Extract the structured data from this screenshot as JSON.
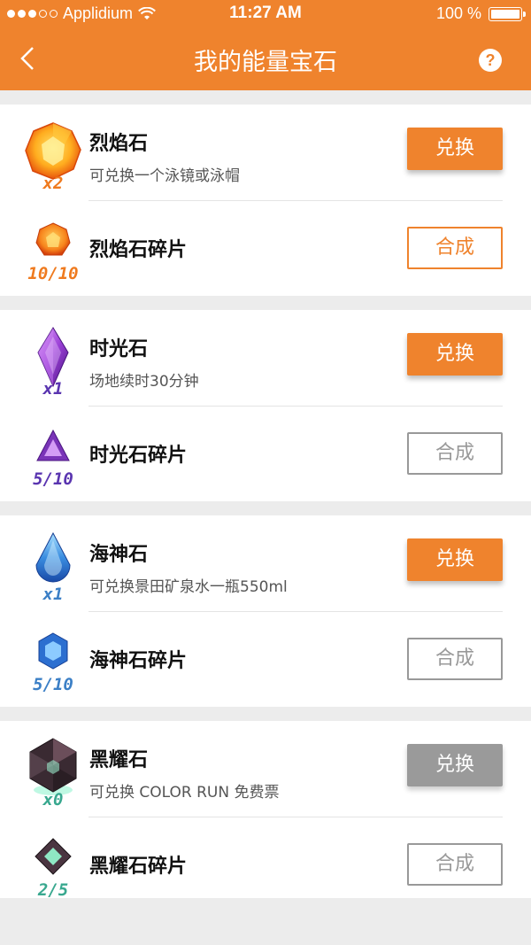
{
  "status_bar": {
    "carrier": "Applidium",
    "time": "11:27 AM",
    "battery": "100 %"
  },
  "nav": {
    "title": "我的能量宝石",
    "back_icon": "chevron-left-icon",
    "help_label": "?"
  },
  "colors": {
    "accent": "#ef832d",
    "disabled": "#9a9a9a",
    "fire": "#ef7a1e",
    "time": "#5a35b0",
    "sea": "#3b7fc6",
    "obsidian": "#39a88f"
  },
  "gems": [
    {
      "name": "烈焰石",
      "desc": "可兑换一个泳镜或泳帽",
      "count": "x2",
      "exchange_label": "兑换",
      "fragment_name": "烈焰石碎片",
      "fragment_count": "10/10",
      "merge_label": "合成"
    },
    {
      "name": "时光石",
      "desc": "场地续时30分钟",
      "count": "x1",
      "exchange_label": "兑换",
      "fragment_name": "时光石碎片",
      "fragment_count": "5/10",
      "merge_label": "合成"
    },
    {
      "name": "海神石",
      "desc": "可兑换景田矿泉水一瓶550ml",
      "count": "x1",
      "exchange_label": "兑换",
      "fragment_name": "海神石碎片",
      "fragment_count": "5/10",
      "merge_label": "合成"
    },
    {
      "name": "黑耀石",
      "desc": "可兑换 COLOR RUN 免费票",
      "count": "x0",
      "exchange_label": "兑换",
      "fragment_name": "黑耀石碎片",
      "fragment_count": "2/5",
      "merge_label": "合成"
    }
  ]
}
